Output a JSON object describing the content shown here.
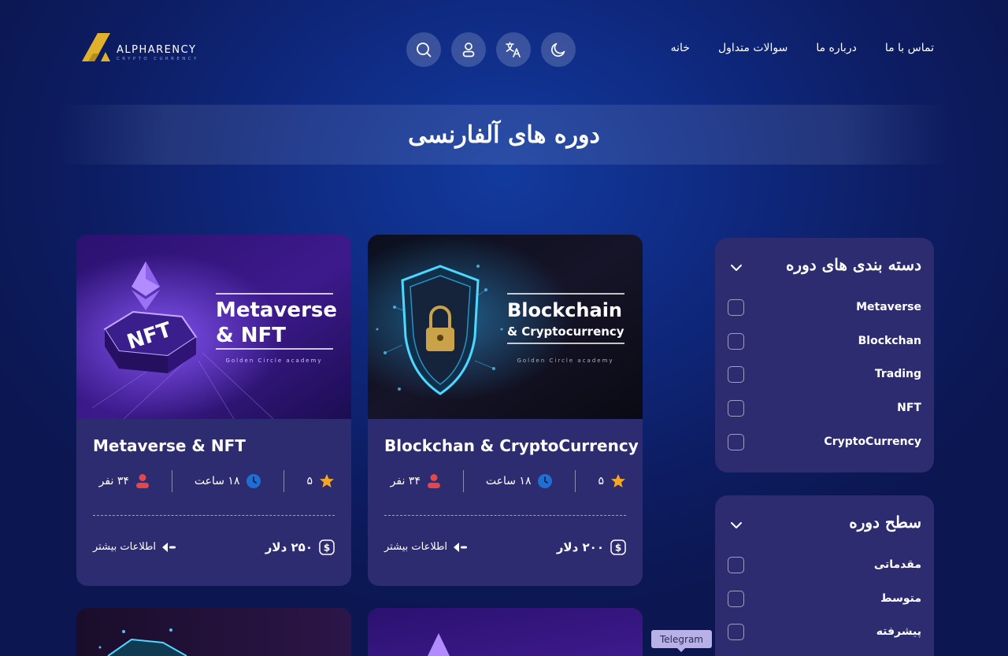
{
  "brand": {
    "name": "ALPHARENCY",
    "tagline": "CRYPTO CURRENCY",
    "logo_color": "#e0b12b"
  },
  "header": {
    "icons": [
      "search-icon",
      "user-icon",
      "translate-icon",
      "moon-icon"
    ],
    "nav": [
      {
        "label": "خانه"
      },
      {
        "label": "سوالات متداول"
      },
      {
        "label": "درباره ما"
      },
      {
        "label": "تماس با ما"
      }
    ]
  },
  "page_title": "دوره های آلفارنسی",
  "courses": [
    {
      "image_title_line1": "Metaverse",
      "image_title_line2": "& NFT",
      "image_caption": "Golden Circle academy",
      "title": "Metaverse & NFT",
      "rating": "۵",
      "duration": "۱۸ ساعت",
      "students": "۳۴ نفر",
      "price": "۲۵۰ دلار",
      "more_label": "اطلاعات بیشتر"
    },
    {
      "image_title_line1": "Blockchain",
      "image_title_line2": "& Cryptocurrency",
      "image_caption": "Golden Circle academy",
      "title": "Blockchan & CryptoCurrency",
      "rating": "۵",
      "duration": "۱۸ ساعت",
      "students": "۳۴ نفر",
      "price": "۲۰۰ دلار",
      "more_label": "اطلاعات بیشتر"
    }
  ],
  "filters": {
    "categories": {
      "title": "دسته بندی های دوره",
      "options": [
        "Metaverse",
        "Blockchan",
        "Trading",
        "NFT",
        "CryptoCurrency"
      ]
    },
    "level": {
      "title": "سطح دوره",
      "options": [
        "مقدماتی",
        "متوسط",
        "پیشرفته"
      ]
    }
  },
  "tooltip": "Telegram",
  "colors": {
    "card_bg": "#2e2c71",
    "star": "#f5a623",
    "clock": "#1f6fd1",
    "person": "#e2474b"
  }
}
